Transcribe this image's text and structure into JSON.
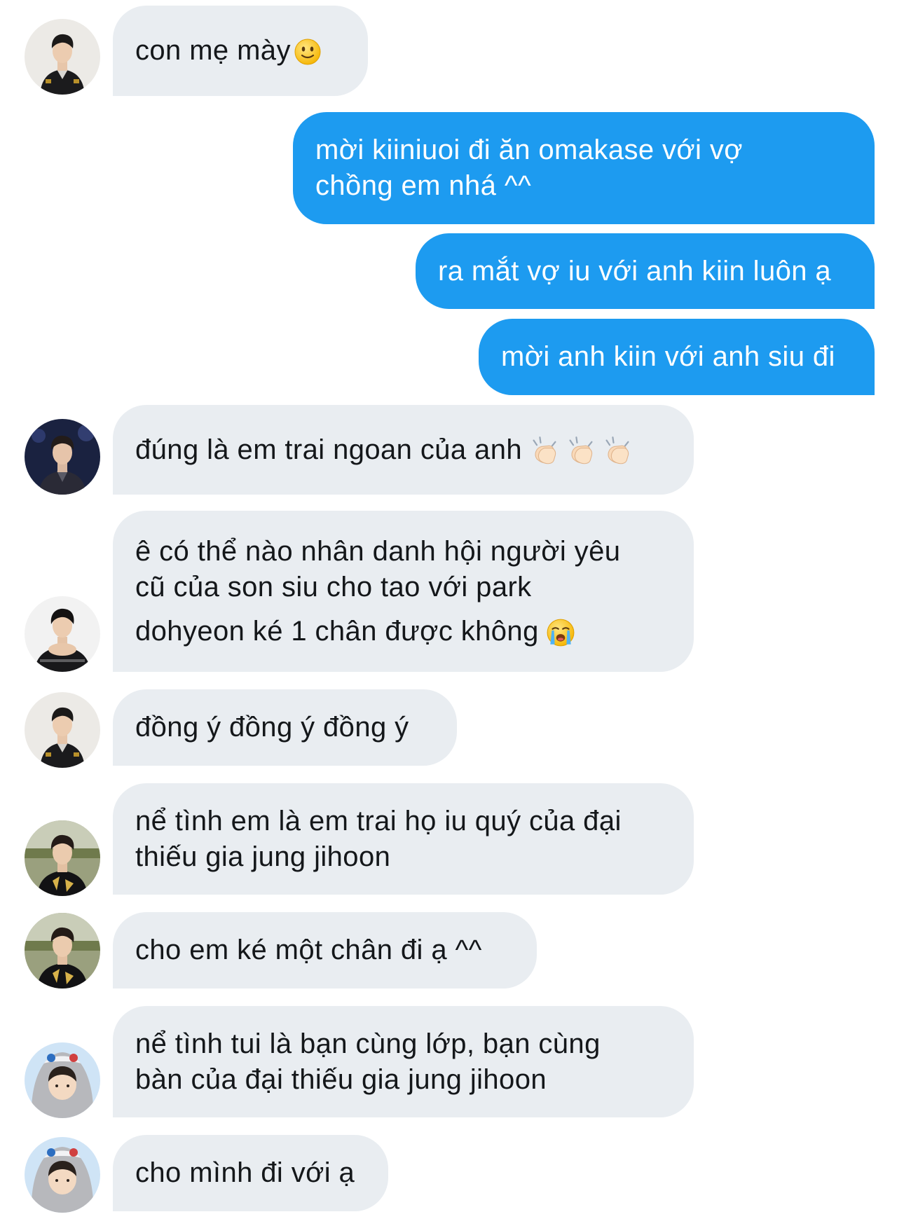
{
  "messages": [
    {
      "direction": "incoming",
      "avatar": "avatar-black-jacket",
      "text": "con mẹ mày",
      "emoji": "slightly-smiling-face-icon"
    },
    {
      "direction": "outgoing",
      "text": "mời kiiniuoi đi ăn omakase với vợ chồng em nhá ^^"
    },
    {
      "direction": "outgoing",
      "text": "ra mắt vợ iu với anh kiin luôn ạ"
    },
    {
      "direction": "outgoing",
      "text": "mời anh kiin với anh siu đi"
    },
    {
      "direction": "incoming",
      "avatar": "avatar-stage-photo",
      "text": "đúng là em trai ngoan của anh",
      "emoji": "clapping-hands-icon x3"
    },
    {
      "direction": "incoming",
      "avatar": "avatar-hands-folded",
      "text": "ê có thể nào nhân danh hội người yêu cũ của son siu cho tao với park dohyeon ké 1 chân được không",
      "emoji": "loudly-crying-face-icon"
    },
    {
      "direction": "incoming",
      "avatar": "avatar-black-jacket",
      "text": "đồng ý đồng ý đồng ý"
    },
    {
      "direction": "incoming",
      "avatar": "avatar-outdoor-jersey",
      "text": "nể tình em là em trai họ iu quý của đại thiếu gia jung jihoon"
    },
    {
      "direction": "incoming",
      "avatar": "avatar-outdoor-jersey",
      "text": "cho em ké một chân đi ạ ^^"
    },
    {
      "direction": "incoming",
      "avatar": "avatar-hooded",
      "text": "nể tình tui là bạn cùng lớp, bạn cùng bàn của đại thiếu gia jung jihoon"
    },
    {
      "direction": "incoming",
      "avatar": "avatar-hooded",
      "text": "cho mình đi với ạ"
    }
  ],
  "colors": {
    "incoming_bubble": "#e9edf1",
    "outgoing_bubble": "#1d9bf0",
    "incoming_text": "#14171a",
    "outgoing_text": "#ffffff"
  },
  "chat": {
    "m1": "con mẹ mày",
    "m2_l1": "mời kiiniuoi đi ăn omakase với vợ",
    "m2_l2": "chồng em nhá ^^",
    "m3": "ra mắt vợ iu với anh kiin luôn ạ",
    "m4": "mời anh kiin với anh siu đi",
    "m5": "đúng là em trai ngoan của anh",
    "m6_l1": "ê có thể nào nhân danh hội người yêu",
    "m6_l2": "cũ của son siu cho tao với park",
    "m6_l3": "dohyeon ké 1 chân được không",
    "m7": "đồng ý đồng ý đồng ý",
    "m8_l1": "nể tình em là em trai họ iu quý của đại",
    "m8_l2": "thiếu gia jung jihoon",
    "m9": "cho em ké một chân đi ạ ^^",
    "m10_l1": "nể tình tui là bạn cùng lớp, bạn cùng",
    "m10_l2": "bàn của đại thiếu gia jung jihoon",
    "m11": "cho mình đi với ạ"
  }
}
